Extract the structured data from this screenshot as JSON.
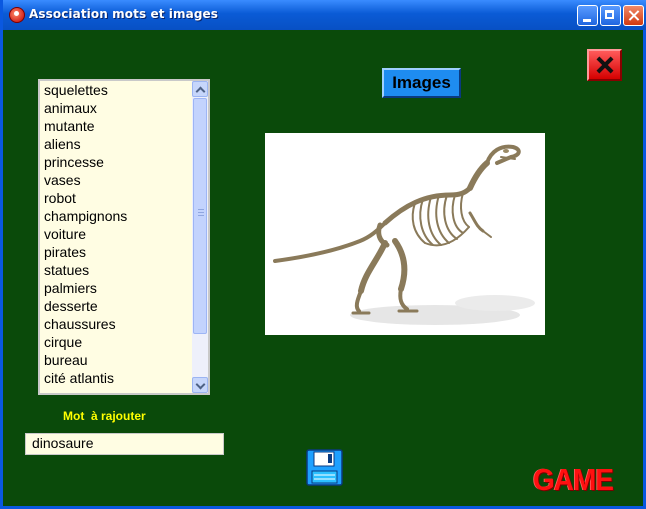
{
  "window": {
    "title": "Association mots et images"
  },
  "word_list": {
    "items": [
      "squelettes",
      "animaux",
      "mutante",
      "aliens",
      "princesse",
      "vases",
      "robot",
      "champignons",
      "voiture",
      "pirates",
      "statues",
      "palmiers",
      "desserte",
      "chaussures",
      "cirque",
      "bureau",
      "cité atlantis"
    ]
  },
  "add_word": {
    "label": "Mot  à rajouter",
    "value": "dinosaure"
  },
  "buttons": {
    "images_label": "Images"
  },
  "picture": {
    "subject": "dinosaur-skeleton"
  },
  "logo": {
    "text": "GAME"
  },
  "colors": {
    "background": "#0c4a0c",
    "label_yellow": "#ffff00",
    "images_button": "#1e8cf0",
    "close_button": "#e00000",
    "logo_red": "#ff1010"
  },
  "icons": {
    "save": "floppy-disk-icon",
    "close": "red-x-icon",
    "window_app": "app-icon"
  }
}
